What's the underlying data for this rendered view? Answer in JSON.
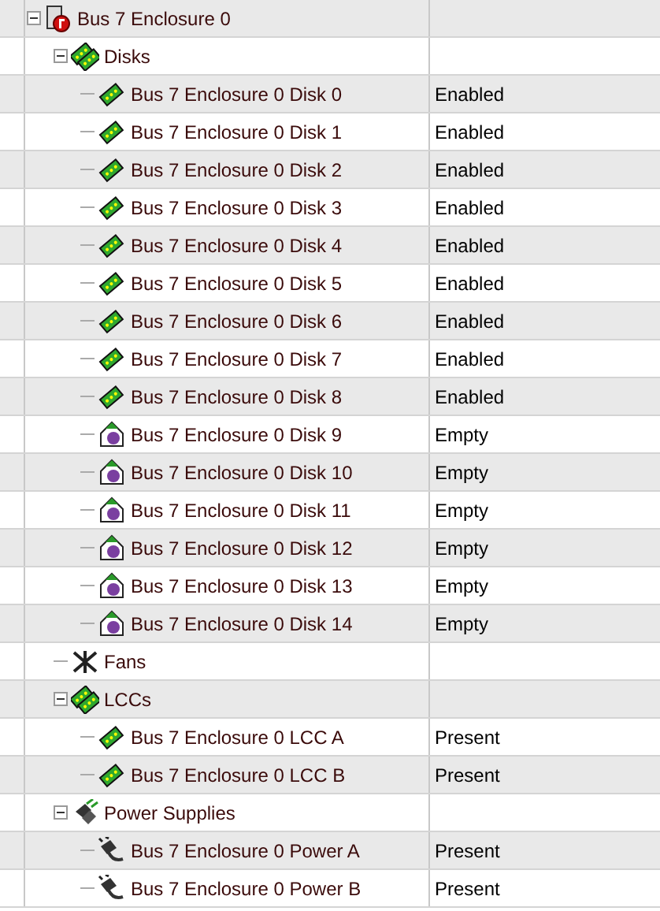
{
  "tree": [
    {
      "label": "Bus 7 Enclosure 0",
      "kind": "enclosure",
      "expanded": true,
      "children": [
        {
          "label": "Disks",
          "kind": "group",
          "expanded": true,
          "children": [
            {
              "label": "Bus 7 Enclosure 0 Disk 0",
              "kind": "disk",
              "status": "Enabled"
            },
            {
              "label": "Bus 7 Enclosure 0 Disk 1",
              "kind": "disk",
              "status": "Enabled"
            },
            {
              "label": "Bus 7 Enclosure 0 Disk 2",
              "kind": "disk",
              "status": "Enabled"
            },
            {
              "label": "Bus 7 Enclosure 0 Disk 3",
              "kind": "disk",
              "status": "Enabled"
            },
            {
              "label": "Bus 7 Enclosure 0 Disk 4",
              "kind": "disk",
              "status": "Enabled"
            },
            {
              "label": "Bus 7 Enclosure 0 Disk 5",
              "kind": "disk",
              "status": "Enabled"
            },
            {
              "label": "Bus 7 Enclosure 0 Disk 6",
              "kind": "disk",
              "status": "Enabled"
            },
            {
              "label": "Bus 7 Enclosure 0 Disk 7",
              "kind": "disk",
              "status": "Enabled"
            },
            {
              "label": "Bus 7 Enclosure 0 Disk 8",
              "kind": "disk",
              "status": "Enabled"
            },
            {
              "label": "Bus 7 Enclosure 0 Disk 9",
              "kind": "empty",
              "status": "Empty"
            },
            {
              "label": "Bus 7 Enclosure 0 Disk 10",
              "kind": "empty",
              "status": "Empty"
            },
            {
              "label": "Bus 7 Enclosure 0 Disk 11",
              "kind": "empty",
              "status": "Empty"
            },
            {
              "label": "Bus 7 Enclosure 0 Disk 12",
              "kind": "empty",
              "status": "Empty"
            },
            {
              "label": "Bus 7 Enclosure 0 Disk 13",
              "kind": "empty",
              "status": "Empty"
            },
            {
              "label": "Bus 7 Enclosure 0 Disk 14",
              "kind": "empty",
              "status": "Empty"
            }
          ]
        },
        {
          "label": "Fans",
          "kind": "fans"
        },
        {
          "label": "LCCs",
          "kind": "group",
          "expanded": true,
          "children": [
            {
              "label": "Bus 7 Enclosure 0 LCC A",
              "kind": "disk",
              "status": "Present"
            },
            {
              "label": "Bus 7 Enclosure 0 LCC B",
              "kind": "disk",
              "status": "Present"
            }
          ]
        },
        {
          "label": "Power Supplies",
          "kind": "power_group",
          "expanded": true,
          "children": [
            {
              "label": "Bus 7 Enclosure 0 Power A",
              "kind": "power",
              "status": "Present"
            },
            {
              "label": "Bus 7 Enclosure 0 Power B",
              "kind": "power",
              "status": "Present"
            }
          ]
        }
      ]
    }
  ]
}
